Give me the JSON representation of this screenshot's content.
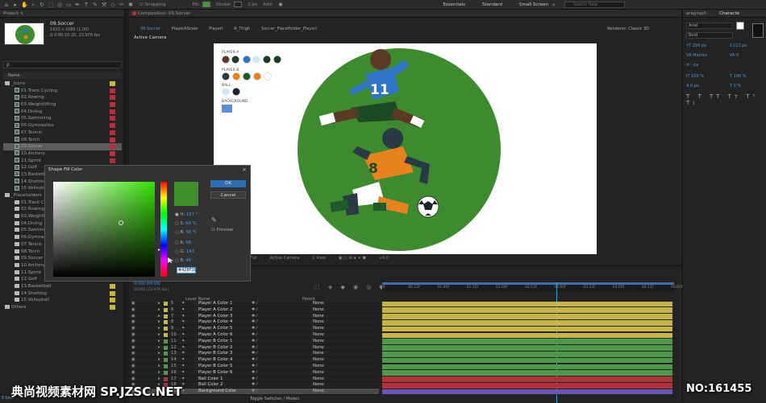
{
  "toolbar": {
    "snapping": "Snapping",
    "fill": "Fill:",
    "stroke": "Stroke:",
    "stroke_width": "2 px",
    "add": "Add:",
    "workspaces": [
      "Essentials",
      "Standard",
      "Small Screen"
    ],
    "search_placeholder": "Search Help"
  },
  "project": {
    "header": "Project",
    "comp_name": "09.Soccer",
    "comp_info": "1920 x 1080 (1.00)",
    "comp_duration": "Δ 0:00:10:20, 23.976 fps",
    "search_placeholder": "ρ",
    "col_name": "Name",
    "items": [
      {
        "label": "_Icons",
        "type": "folder",
        "indent": 0
      },
      {
        "label": "01.Track Cycling",
        "type": "comp",
        "indent": 1
      },
      {
        "label": "02.Rowing",
        "type": "comp",
        "indent": 1
      },
      {
        "label": "03.Weightlifting",
        "type": "comp",
        "indent": 1
      },
      {
        "label": "04.Diving",
        "type": "comp",
        "indent": 1
      },
      {
        "label": "05.Swimming",
        "type": "comp",
        "indent": 1
      },
      {
        "label": "06.Gymnastics",
        "type": "comp",
        "indent": 1
      },
      {
        "label": "07.Tennis",
        "type": "comp",
        "indent": 1
      },
      {
        "label": "08.Torch",
        "type": "comp",
        "indent": 1
      },
      {
        "label": "09.Soccer",
        "type": "comp",
        "indent": 1,
        "selected": true
      },
      {
        "label": "10.Archery",
        "type": "comp",
        "indent": 1
      },
      {
        "label": "11.Sprint",
        "type": "comp",
        "indent": 1
      },
      {
        "label": "12.Golf",
        "type": "comp",
        "indent": 1
      },
      {
        "label": "13.Basketb",
        "type": "comp",
        "indent": 1
      },
      {
        "label": "14.Shotting",
        "type": "comp",
        "indent": 1
      },
      {
        "label": "15.Volleyb",
        "type": "comp",
        "indent": 1
      },
      {
        "label": "_Placeholders",
        "type": "folder",
        "indent": 0
      },
      {
        "label": "01.Track Cy",
        "type": "folder",
        "indent": 1
      },
      {
        "label": "02.Rowing",
        "type": "folder",
        "indent": 1
      },
      {
        "label": "03.Weightli",
        "type": "folder",
        "indent": 1
      },
      {
        "label": "04.Diving",
        "type": "folder",
        "indent": 1
      },
      {
        "label": "05.Swimmin",
        "type": "folder",
        "indent": 1
      },
      {
        "label": "06.Gymnast",
        "type": "folder",
        "indent": 1
      },
      {
        "label": "07.Tennis",
        "type": "folder",
        "indent": 1
      },
      {
        "label": "08.Torch",
        "type": "folder",
        "indent": 1
      },
      {
        "label": "09.Soccer",
        "type": "folder",
        "indent": 1
      },
      {
        "label": "10.Archery",
        "type": "folder",
        "indent": 1
      },
      {
        "label": "11.Sprint",
        "type": "folder",
        "indent": 1
      },
      {
        "label": "12.Golf",
        "type": "folder",
        "indent": 1
      },
      {
        "label": "13.Basketball",
        "type": "folder",
        "indent": 1
      },
      {
        "label": "14.Shotting",
        "type": "folder",
        "indent": 1
      },
      {
        "label": "15.Volleyball",
        "type": "folder",
        "indent": 1
      },
      {
        "label": "Others",
        "type": "folder",
        "indent": 0
      }
    ],
    "bpc": "8 bpc"
  },
  "composition": {
    "header": "Composition: 09.Soccer",
    "tabs": [
      "09.Soccer",
      "PlayerAScale",
      "Playerl",
      "R_Thigh",
      "Soccer_PlaceHolder_Playerl"
    ],
    "renderer_label": "Renderer:",
    "renderer_value": "Classic 3D",
    "view_label": "Active Camera",
    "footer": {
      "zoom": "Full",
      "camera": "Active Camera",
      "views": "1 View",
      "exposure": "+0.0"
    },
    "legend": {
      "player_a": "PLAYER A",
      "player_b": "PLAYER B",
      "ball": "BALL",
      "background": "BACKGROUND"
    },
    "player_a_number": "11",
    "player_b_number": "8"
  },
  "colors": {
    "bg_green": "#3d8b2e",
    "player_a_blue": "#2e75c9",
    "player_b_orange": "#e8821f",
    "skin_a": "#5a3a25",
    "skin_b": "#2a3a44",
    "pants_a": "#1c4a25",
    "selection": "#5b5b5b"
  },
  "dialog": {
    "title": "Shape Fill Color",
    "ok": "OK",
    "cancel": "Cancel",
    "h_label": "H:",
    "h_value": "107 °",
    "s_label": "S:",
    "s_value": "69 %",
    "b_label": "B:",
    "b_value": "56 %",
    "r_label": "R:",
    "r_value": "66",
    "g_label": "G:",
    "g_value": "143",
    "bl_label": "B:",
    "bl_value": "45",
    "hex": "#428F2D",
    "preview": "Preview"
  },
  "timeline": {
    "timecode": "0:00:00:00",
    "frames": "00000 (23.976 fps)",
    "col_layer": "Layer Name",
    "col_parent": "Parent",
    "toggle_label": "Toggle Switches / Modes",
    "ticks": [
      "00f",
      "00:12f",
      "01:00f",
      "01:12f",
      "02:00f",
      "02:12f",
      "03:00f",
      "03:12f",
      "04:00f",
      "04:12f",
      "05:00f"
    ],
    "layers": [
      {
        "num": "5",
        "name": "Player A Color 1",
        "color": "#c8b545"
      },
      {
        "num": "6",
        "name": "Player A Color 2",
        "color": "#c8b545"
      },
      {
        "num": "7",
        "name": "Player A Color 3",
        "color": "#c8b545"
      },
      {
        "num": "8",
        "name": "Player A Color 4",
        "color": "#c8b545"
      },
      {
        "num": "9",
        "name": "Player A Color 5",
        "color": "#c8b545"
      },
      {
        "num": "10",
        "name": "Player A Color 6",
        "color": "#c8b545"
      },
      {
        "num": "11",
        "name": "Player B Color 1",
        "color": "#4f9a4a"
      },
      {
        "num": "12",
        "name": "Player B Color 2",
        "color": "#4f9a4a"
      },
      {
        "num": "13",
        "name": "Player B Color 3",
        "color": "#4f9a4a"
      },
      {
        "num": "14",
        "name": "Player B Color 4",
        "color": "#4f9a4a"
      },
      {
        "num": "15",
        "name": "Player B Color 5",
        "color": "#4f9a4a"
      },
      {
        "num": "16",
        "name": "Player B Color 6",
        "color": "#4f9a4a"
      },
      {
        "num": "17",
        "name": "Ball Color 1",
        "color": "#b0333b"
      },
      {
        "num": "18",
        "name": "Ball Color 2",
        "color": "#b0333b"
      },
      {
        "num": "19",
        "name": "Background Color",
        "color": "#6b55b5"
      }
    ],
    "parent_value": "None"
  },
  "character": {
    "header_tabs": [
      "aragraph",
      "Characte"
    ],
    "font": "Arial",
    "style": "Bold",
    "size": "209 px",
    "leading": "112 px",
    "kerning": "Metrics",
    "tracking": "0",
    "stroke": "- px",
    "vscale": "100 %",
    "hscale": "100 %",
    "baseline": "0 px",
    "tsume": "0 %"
  },
  "watermark": {
    "site": "典尚视频素材网 SP.JZSC.NET",
    "number": "NO:161455"
  }
}
